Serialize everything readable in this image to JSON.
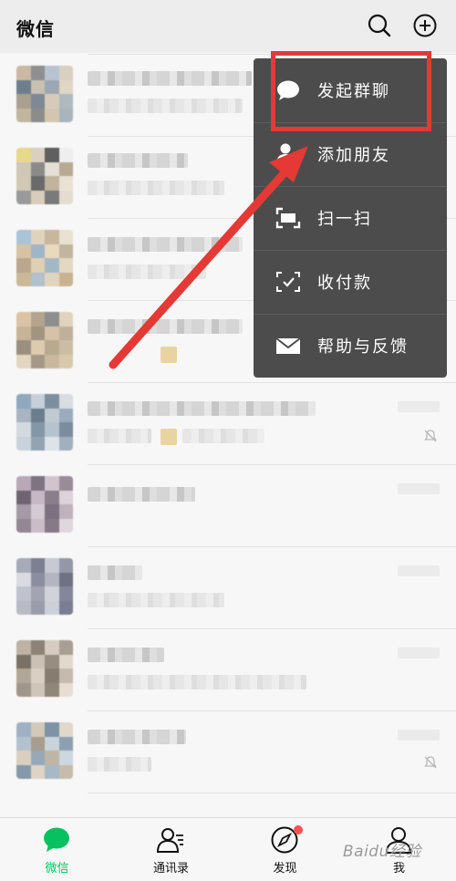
{
  "header": {
    "title": "微信",
    "search_icon": "search-icon",
    "add_icon": "plus-circle-icon"
  },
  "menu": {
    "items": [
      {
        "label": "发起群聊",
        "icon": "chat-bubble-icon"
      },
      {
        "label": "添加朋友",
        "icon": "add-friend-icon"
      },
      {
        "label": "扫一扫",
        "icon": "scan-icon"
      },
      {
        "label": "收付款",
        "icon": "payment-icon"
      },
      {
        "label": "帮助与反馈",
        "icon": "mail-icon"
      }
    ],
    "highlight_color": "#e53935"
  },
  "chats": {
    "count": 9,
    "muted_rows": [
      4,
      8
    ]
  },
  "tabbar": {
    "tabs": [
      {
        "label": "微信",
        "icon": "chat-icon",
        "active": true
      },
      {
        "label": "通讯录",
        "icon": "contacts-icon",
        "active": false
      },
      {
        "label": "发现",
        "icon": "compass-icon",
        "active": false
      },
      {
        "label": "我",
        "icon": "me-icon",
        "active": false
      }
    ],
    "active_color": "#07c160",
    "badge_color": "#fa5151"
  },
  "watermark": "Baidu经验"
}
